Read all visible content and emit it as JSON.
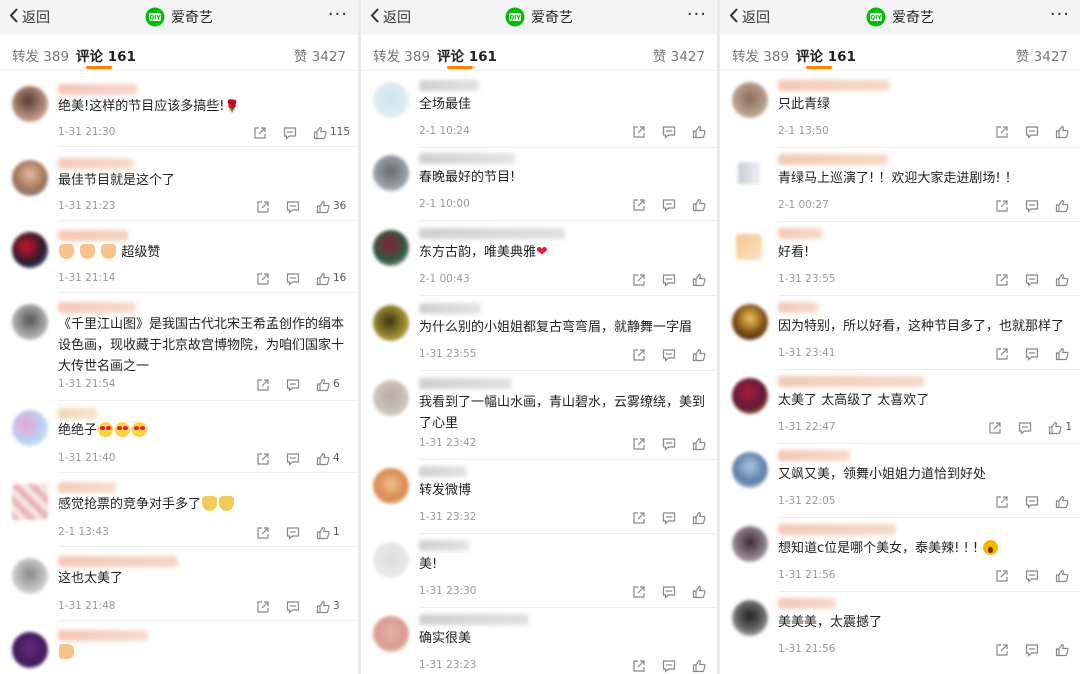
{
  "header": {
    "back_label": "返回",
    "app_name": "爱奇艺",
    "more_label": "···"
  },
  "tabs": {
    "repost": "转发 389",
    "comment": "评论 161",
    "like": "赞 3427"
  },
  "colors": {
    "accent": "#ff8200",
    "brand_green": "#00be06"
  },
  "icons": {
    "share": "share-icon",
    "comment": "comment-icon",
    "like": "thumbs-up-icon"
  },
  "panels": [
    {
      "comments": [
        {
          "text": "绝美!这样的节目应该多搞些!",
          "emoji": "rose",
          "time": "1-31 21:30",
          "likes": "115"
        },
        {
          "text": "最佳节目就是这个了",
          "time": "1-31 21:23",
          "likes": "36"
        },
        {
          "text": "超级赞",
          "emoji_prefix": "clap-clap-clap",
          "time": "1-31 21:14",
          "likes": "16"
        },
        {
          "text": "《千里江山图》是我国古代北宋王希孟创作的绢本设色画，现收藏于北京故宫博物院，为咱们国家十大传世名画之一",
          "time": "1-31 21:54",
          "likes": "6"
        },
        {
          "text": "绝绝子",
          "emoji": "heart-eyes-x3",
          "time": "1-31 21:40",
          "likes": "4"
        },
        {
          "text": "感觉抢票的竞争对手多了",
          "emoji": "cat-x2",
          "time": "2-1 13:43",
          "likes": "1"
        },
        {
          "text": "这也太美了",
          "time": "1-31 21:48",
          "likes": "3"
        },
        {
          "text": "",
          "emoji": "thumb"
        }
      ]
    },
    {
      "comments": [
        {
          "text": "全场最佳",
          "time": "2-1 10:24",
          "likes": ""
        },
        {
          "text": "春晚最好的节目!",
          "time": "2-1 10:00",
          "likes": ""
        },
        {
          "text": "东方古韵，唯美典雅",
          "emoji": "heart",
          "time": "2-1 00:43",
          "likes": ""
        },
        {
          "text": "为什么别的小姐姐都复古弯弯眉，就静舞一字眉",
          "time": "1-31 23:55",
          "likes": ""
        },
        {
          "text": "我看到了一幅山水画，青山碧水，云雾缭绕，美到了心里",
          "time": "1-31 23:42",
          "likes": ""
        },
        {
          "text": "转发微博",
          "time": "1-31 23:32",
          "likes": ""
        },
        {
          "text": "美!",
          "time": "1-31 23:30",
          "likes": ""
        },
        {
          "text": "确实很美",
          "time": "1-31 23:23",
          "likes": ""
        }
      ]
    },
    {
      "comments": [
        {
          "text": "只此青绿",
          "time": "2-1 13:50",
          "likes": ""
        },
        {
          "text": "青绿马上巡演了! ！欢迎大家走进剧场! ！",
          "time": "2-1 00:27",
          "likes": ""
        },
        {
          "text": "好看!",
          "time": "1-31 23:55",
          "likes": ""
        },
        {
          "text": "因为特别，所以好看，这种节目多了，也就那样了",
          "time": "1-31 23:41",
          "likes": ""
        },
        {
          "text": "太美了 太高级了 太喜欢了",
          "time": "1-31 22:47",
          "likes": "1"
        },
        {
          "text": "又飒又美，领舞小姐姐力道恰到好处",
          "time": "1-31 22:05",
          "likes": ""
        },
        {
          "text": "想知道c位是哪个美女，泰美辣! ! !",
          "emoji": "scream",
          "time": "1-31 21:56",
          "likes": ""
        },
        {
          "text": "美美美，太震撼了",
          "time": "1-31 21:56",
          "likes": ""
        }
      ]
    }
  ]
}
